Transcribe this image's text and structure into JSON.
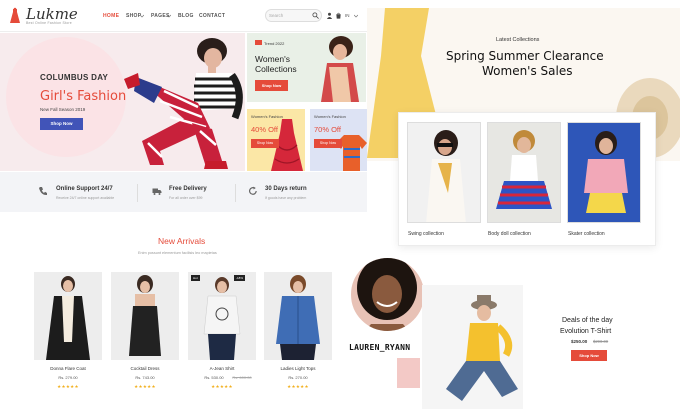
{
  "header": {
    "logo": "Lukme",
    "tagline": "Best Online Fashion Store",
    "nav": [
      "HOME",
      "SHOP",
      "PAGES",
      "BLOG",
      "CONTACT"
    ],
    "search_placeholder": "Search",
    "lang": "IN"
  },
  "hero": {
    "eyebrow": "COLUMBUS DAY",
    "title": "Girl's Fashion",
    "subtitle": "New Fall Season 2019",
    "button": "Shop Now"
  },
  "promos": [
    {
      "tag": "Trend 2022",
      "title_1": "Women's",
      "title_2": "Collections",
      "button": "Shop Now"
    },
    {
      "label": "Women's Fashion",
      "offer": "40% Off",
      "button": "Shop Now"
    },
    {
      "label": "Women's Fashion",
      "offer": "70% Off",
      "button": "Shop Now"
    }
  ],
  "features": [
    {
      "title": "Online Support 24/7",
      "subtitle": "Receive 24/7 online support available"
    },
    {
      "title": "Free Delivery",
      "subtitle": "For all order over $99"
    },
    {
      "title": "30 Days return",
      "subtitle": "If goods have any problem"
    }
  ],
  "new_arrivals": {
    "title": "New Arrivals",
    "subtitle": "Enim possunt elementum facilisis leo mapietas",
    "products": [
      {
        "name": "Donna Flare Coat",
        "price": "Rs. 279.00",
        "rating": "★★★★★",
        "badge": ""
      },
      {
        "name": "Cocktail Dress",
        "price": "Rs. 743.00",
        "rating": "★★★★★",
        "badge": ""
      },
      {
        "name": "A-Jean Shirt",
        "price": "Rs. 530.00",
        "old_price": "Rs. 600.00",
        "rating": "★★★★★",
        "badge": "Hot"
      },
      {
        "name": "Ladies Light Tops",
        "price": "Rs. 270.00",
        "rating": "★★★★★",
        "badge": ""
      }
    ],
    "badges": {
      "hot": "Hot",
      "sale": "-18%"
    }
  },
  "collections": {
    "subtitle": "Latest Collections",
    "title_1": "Spring Summer Clearance",
    "title_2": "Women's Sales",
    "items": [
      "Swing collection",
      "Body doll collection",
      "Skater collection"
    ]
  },
  "portrait": {
    "name": "LAUREN_RYANN"
  },
  "deal": {
    "title_1": "Deals of the day",
    "title_2": "Evolution T-Shirt",
    "price": "$250.00",
    "old_price": "$290.00",
    "button": "Shop Now"
  },
  "colors": {
    "accent": "#e54b3a",
    "hero_button": "#4154b8",
    "star": "#f2b01e"
  }
}
